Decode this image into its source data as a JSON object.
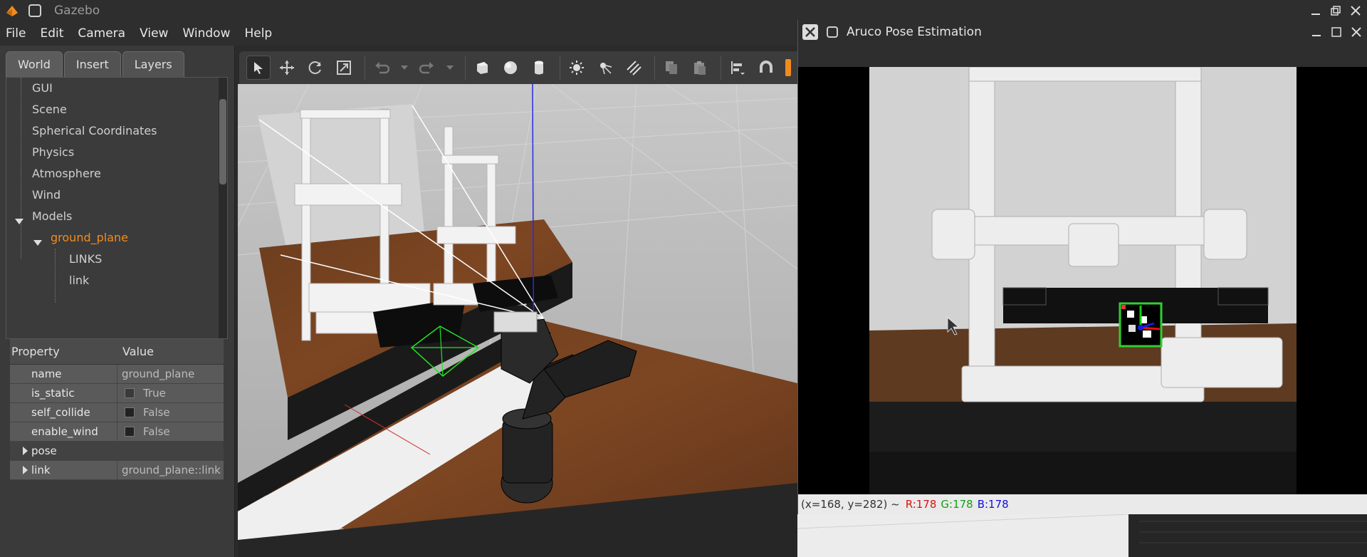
{
  "main_window": {
    "title": "Gazebo",
    "menu": [
      "File",
      "Edit",
      "Camera",
      "View",
      "Window",
      "Help"
    ]
  },
  "left_panel": {
    "tabs": [
      "World",
      "Insert",
      "Layers"
    ],
    "active_tab": "World",
    "tree": {
      "gui": "GUI",
      "scene": "Scene",
      "spherical": "Spherical Coordinates",
      "physics": "Physics",
      "atmosphere": "Atmosphere",
      "wind": "Wind",
      "models": "Models",
      "ground_plane": "ground_plane",
      "links": "LINKS",
      "link": "link"
    },
    "properties": {
      "header_property": "Property",
      "header_value": "Value",
      "name_key": "name",
      "name_val": "ground_plane",
      "is_static_key": "is_static",
      "is_static_val": "True",
      "self_collide_key": "self_collide",
      "self_collide_val": "False",
      "enable_wind_key": "enable_wind",
      "enable_wind_val": "False",
      "pose_key": "pose",
      "link_key": "link",
      "link_val": "ground_plane::link"
    }
  },
  "toolbar": {
    "icons": [
      "select-arrow-icon",
      "translate-icon",
      "rotate-icon",
      "scale-icon",
      "undo-icon",
      "redo-icon",
      "box-icon",
      "sphere-icon",
      "cylinder-icon",
      "point-light-icon",
      "spot-light-icon",
      "directional-light-icon",
      "copy-icon",
      "paste-icon",
      "align-icon",
      "snap-icon"
    ]
  },
  "aruco_window": {
    "title": "Aruco Pose Estimation",
    "status_coords": "(x=168, y=282) ~",
    "status_r": "R:178",
    "status_g": "G:178",
    "status_b": "B:178"
  },
  "colors": {
    "selected_tree_item": "#f28b1e",
    "status_r": "#e01010",
    "status_g": "#10a010",
    "status_b": "#1010e0"
  }
}
